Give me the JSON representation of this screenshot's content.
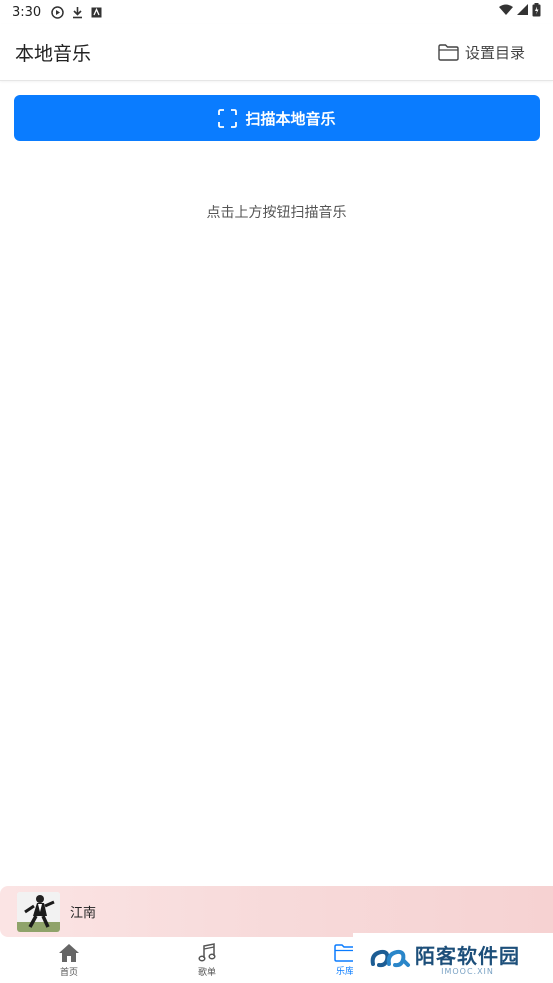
{
  "status": {
    "time": "3:30"
  },
  "header": {
    "title": "本地音乐",
    "dir_label": "设置目录"
  },
  "scan_button": {
    "label": "扫描本地音乐"
  },
  "empty_hint": "点击上方按钮扫描音乐",
  "player": {
    "song": "江南"
  },
  "nav": {
    "items": [
      {
        "label": "首页"
      },
      {
        "label": "歌单"
      },
      {
        "label": "乐库"
      }
    ]
  },
  "watermark": {
    "main": "陌客软件园",
    "sub": "IMOOC.XIN"
  },
  "colors": {
    "accent": "#0a7cff"
  }
}
